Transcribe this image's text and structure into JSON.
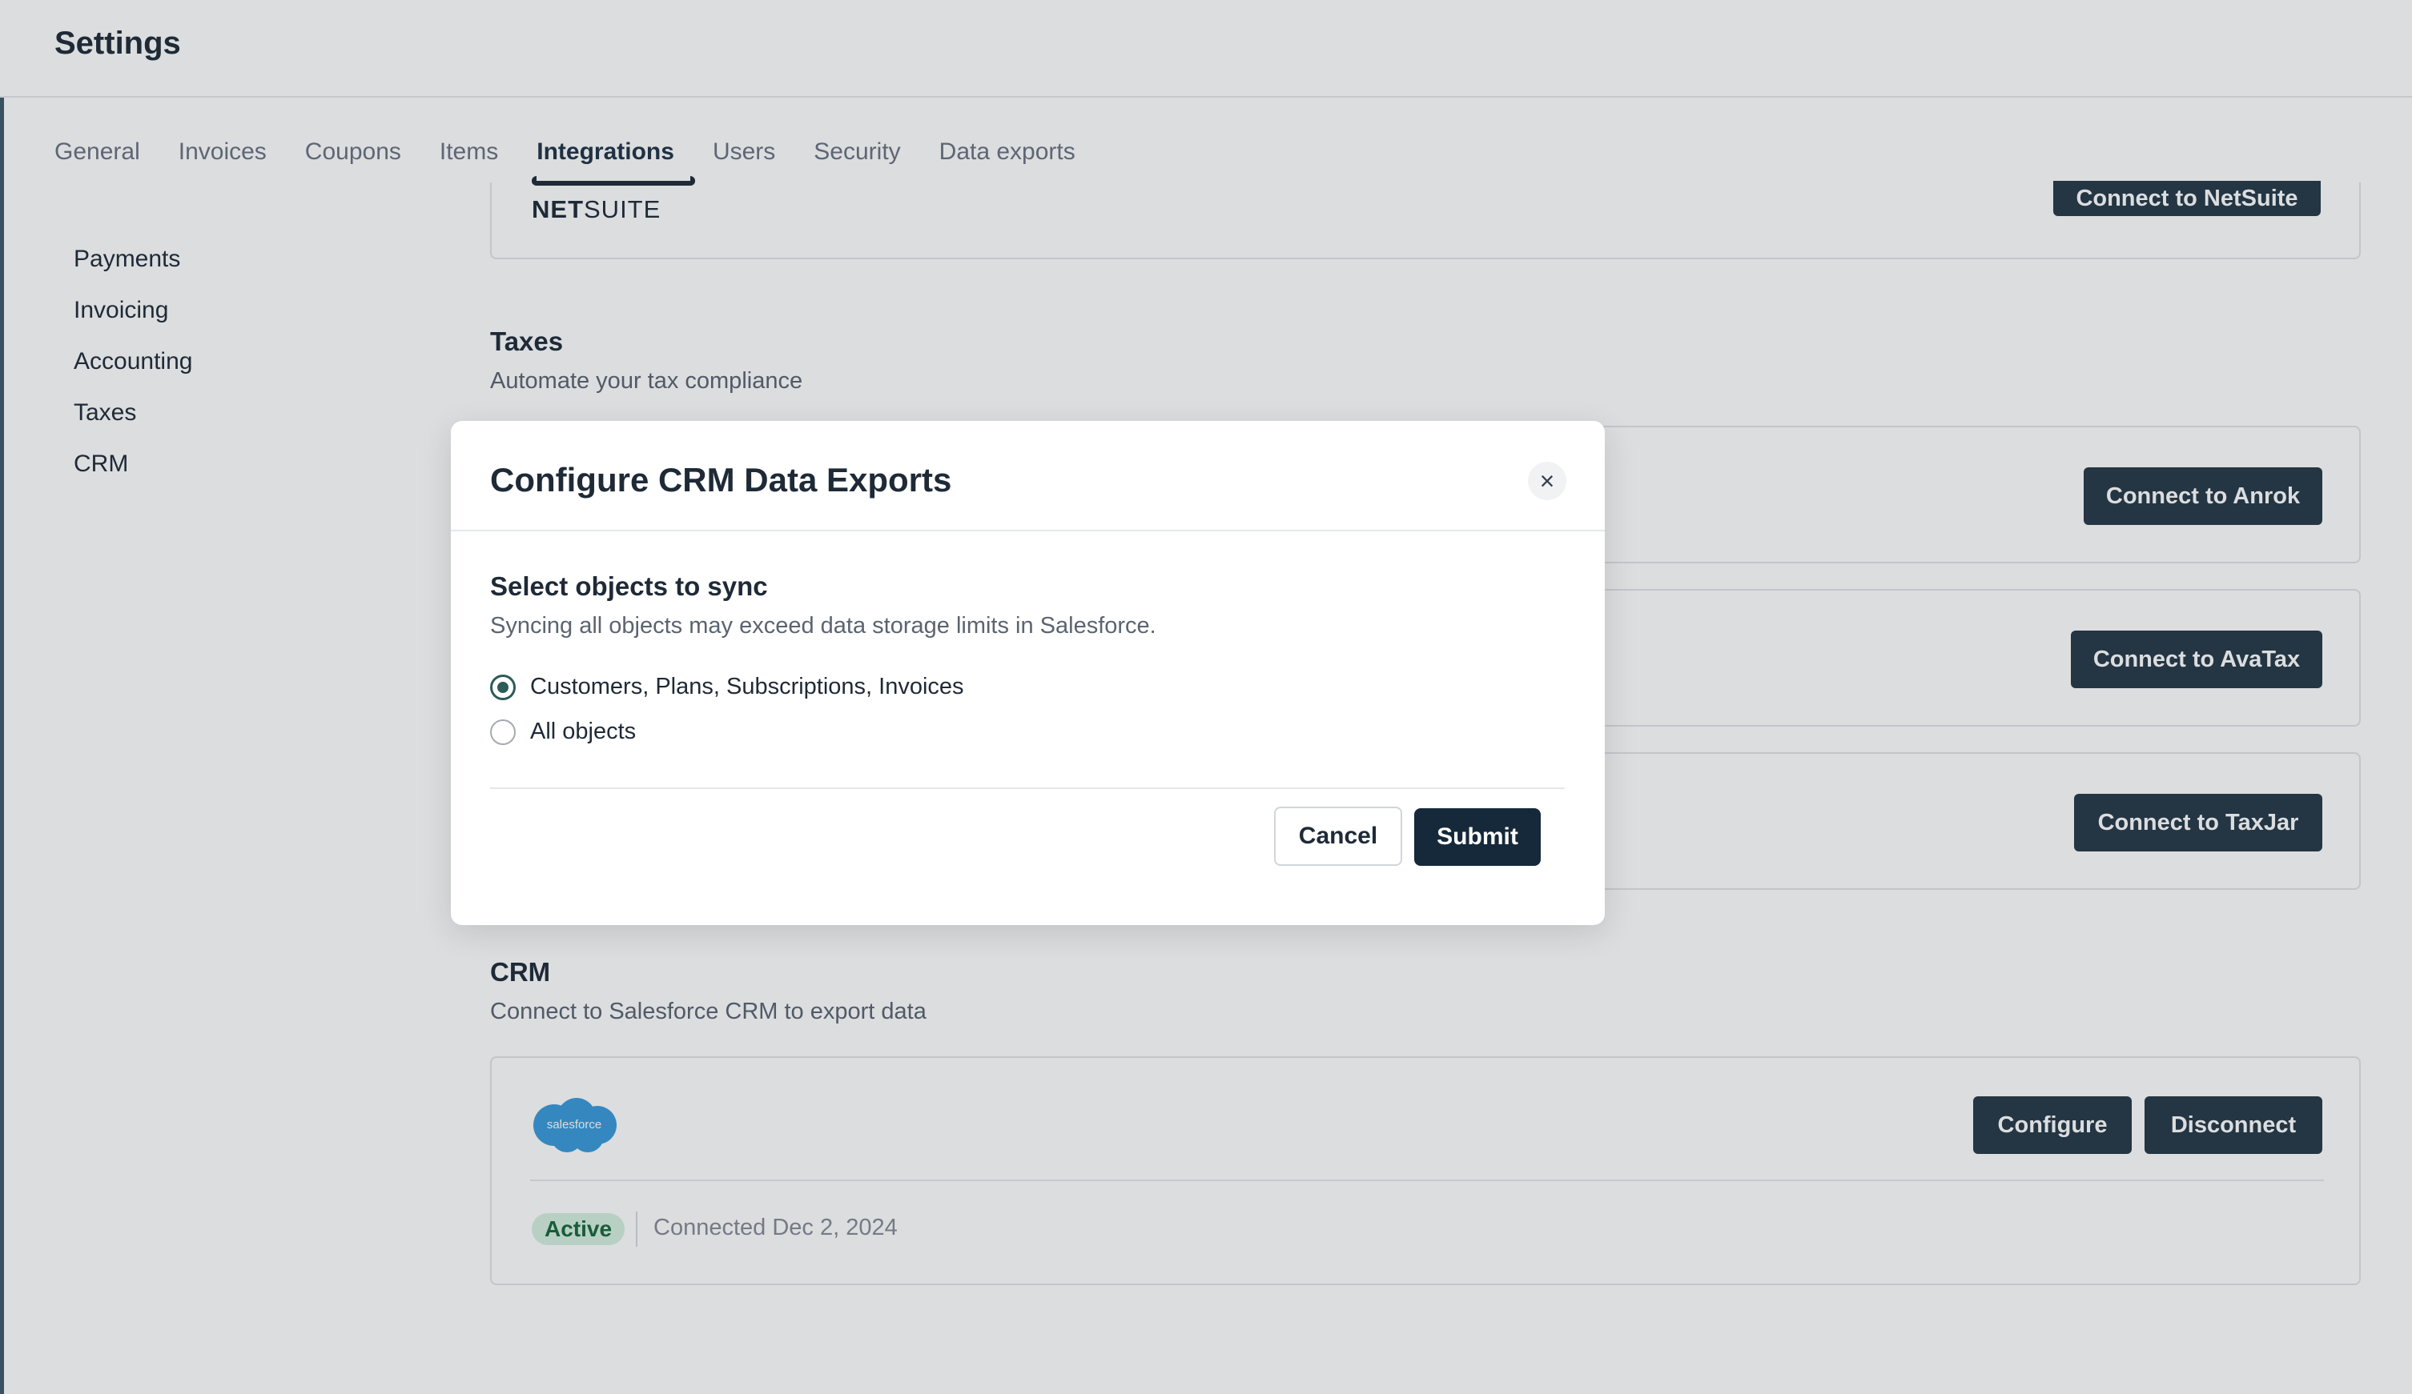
{
  "header": {
    "title": "Settings"
  },
  "tabs": [
    {
      "label": "General"
    },
    {
      "label": "Invoices"
    },
    {
      "label": "Coupons"
    },
    {
      "label": "Items"
    },
    {
      "label": "Integrations",
      "active": true
    },
    {
      "label": "Users"
    },
    {
      "label": "Security"
    },
    {
      "label": "Data exports"
    }
  ],
  "sidebar": {
    "items": [
      {
        "label": "Payments"
      },
      {
        "label": "Invoicing"
      },
      {
        "label": "Accounting"
      },
      {
        "label": "Taxes"
      },
      {
        "label": "CRM"
      }
    ]
  },
  "accounting": {
    "netsuite": {
      "logo_bold": "NET",
      "logo_rest": "SUITE",
      "connect_label": "Connect to NetSuite"
    }
  },
  "taxes": {
    "title": "Taxes",
    "subtitle": "Automate your tax compliance",
    "anrok_label": "Connect to Anrok",
    "avatax_label": "Connect to AvaTax",
    "taxjar_label": "Connect to TaxJar"
  },
  "crm": {
    "title": "CRM",
    "subtitle": "Connect to Salesforce CRM to export data",
    "logo_text": "salesforce",
    "configure_label": "Configure",
    "disconnect_label": "Disconnect",
    "status": "Active",
    "connected_text": "Connected Dec 2, 2024"
  },
  "modal": {
    "title": "Configure CRM Data Exports",
    "close_symbol": "×",
    "heading": "Select objects to sync",
    "description": "Syncing all objects may exceed data storage limits in Salesforce.",
    "options": [
      {
        "label": "Customers, Plans, Subscriptions, Invoices",
        "selected": true
      },
      {
        "label": "All objects",
        "selected": false
      }
    ],
    "cancel_label": "Cancel",
    "submit_label": "Submit"
  },
  "colors": {
    "primary_button": "#253746",
    "submit_button": "#15293a",
    "active_badge_bg": "#d6f0de",
    "active_badge_text": "#19663a",
    "salesforce_blue": "#3a9ad9",
    "radio_selected": "#2d5b57"
  }
}
